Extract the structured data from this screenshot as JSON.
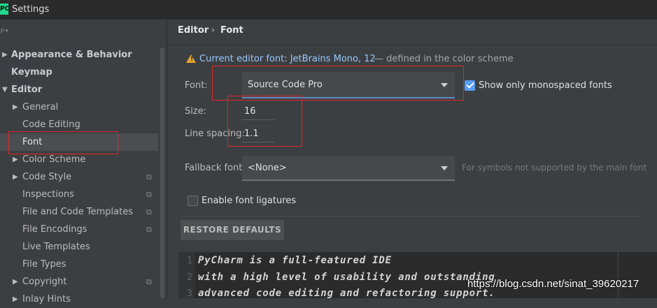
{
  "window": {
    "title": "Settings",
    "app_icon_text": "PC"
  },
  "search": {
    "icon": "search-icon"
  },
  "sidebar": {
    "items": [
      {
        "label": "Appearance & Behavior",
        "expandable": true,
        "expanded": false
      },
      {
        "label": "Keymap",
        "expandable": false
      },
      {
        "label": "Editor",
        "expandable": true,
        "expanded": true
      },
      {
        "label": "General",
        "expandable": true,
        "expanded": false
      },
      {
        "label": "Code Editing",
        "expandable": false
      },
      {
        "label": "Font",
        "expandable": false,
        "selected": true
      },
      {
        "label": "Color Scheme",
        "expandable": true,
        "expanded": false
      },
      {
        "label": "Code Style",
        "expandable": true,
        "expanded": false,
        "project_icon": true
      },
      {
        "label": "Inspections",
        "expandable": false,
        "project_icon": true
      },
      {
        "label": "File and Code Templates",
        "expandable": false,
        "project_icon": true
      },
      {
        "label": "File Encodings",
        "expandable": false,
        "project_icon": true
      },
      {
        "label": "Live Templates",
        "expandable": false
      },
      {
        "label": "File Types",
        "expandable": false
      },
      {
        "label": "Copyright",
        "expandable": true,
        "expanded": false,
        "project_icon": true
      },
      {
        "label": "Inlay Hints",
        "expandable": true,
        "expanded": false
      }
    ]
  },
  "breadcrumb": {
    "parent": "Editor",
    "separator": "›",
    "current": "Font"
  },
  "warning": {
    "text": "Current editor font: JetBrains Mono, 12",
    "suffix": "— defined in the color scheme"
  },
  "form": {
    "font_label": "Font:",
    "font_value": "Source Code Pro",
    "monospaced_label": "Show only monospaced fonts",
    "monospaced_checked": true,
    "size_label": "Size:",
    "size_value": "16",
    "line_spacing_label": "Line spacing:",
    "line_spacing_value": "1.1",
    "fallback_label": "Fallback font:",
    "fallback_value": "<None>",
    "fallback_hint": "For symbols not supported by the main font",
    "ligatures_label": "Enable font ligatures",
    "ligatures_checked": false,
    "restore_label": "RESTORE DEFAULTS"
  },
  "preview": {
    "lines": [
      {
        "n": "1",
        "text": "PyCharm is a full-featured IDE"
      },
      {
        "n": "2",
        "text": "with a high level of usability and outstanding"
      },
      {
        "n": "3",
        "text": "advanced code editing and refactoring support."
      }
    ]
  },
  "watermark": "https://blog.csdn.net/sinat_39620217",
  "colors": {
    "background": "#3c3f41",
    "accent": "#589df6",
    "annotation": "#e0252b"
  }
}
